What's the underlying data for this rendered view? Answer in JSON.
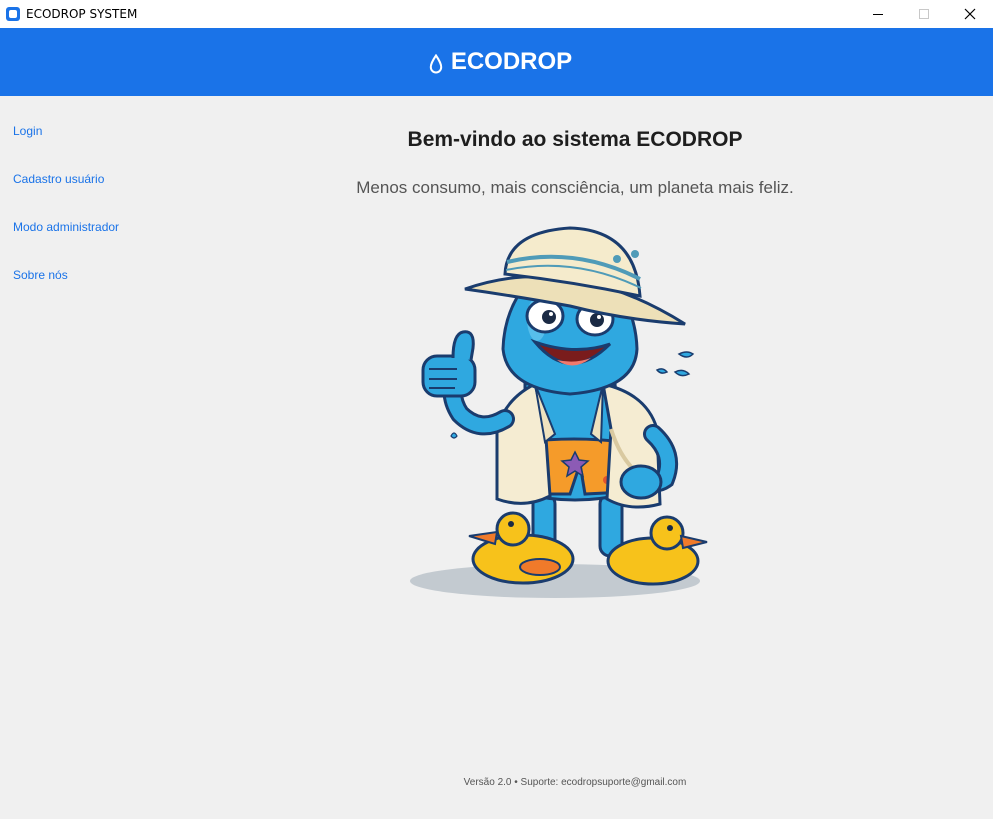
{
  "window": {
    "title": "ECODROP SYSTEM"
  },
  "header": {
    "title": "ECODROP",
    "accent_color": "#1a73e8",
    "icon": "water-drop-icon"
  },
  "sidebar": {
    "items": [
      {
        "label": "Login"
      },
      {
        "label": "Cadastro usuário"
      },
      {
        "label": "Modo administrador"
      },
      {
        "label": "Sobre nós"
      }
    ]
  },
  "main": {
    "welcome": "Bem-vindo ao sistema ECODROP",
    "tagline": "Menos consumo, mais consciência, um planeta mais feliz.",
    "mascot": "water-drop-mascot-illustration"
  },
  "footer": {
    "text": "Versão 2.0 • Suporte: ecodropsuporte@gmail.com"
  }
}
